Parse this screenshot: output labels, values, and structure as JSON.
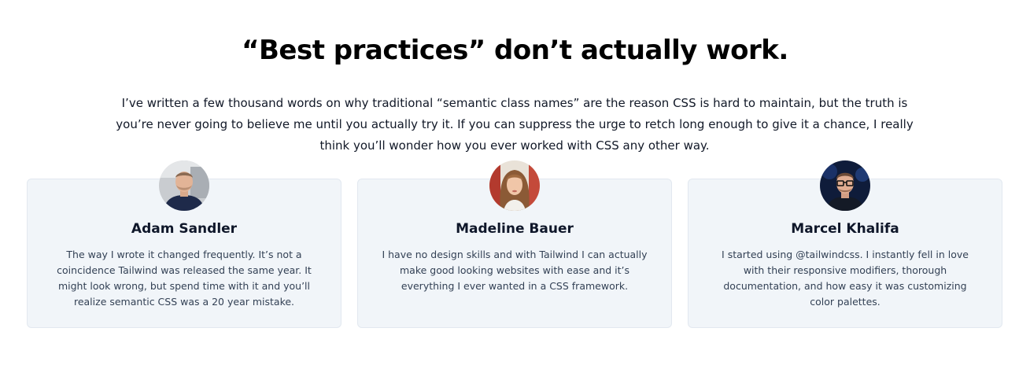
{
  "headline": "“Best practices” don’t actually work.",
  "intro": "I’ve written a few thousand words on why traditional “semantic class names” are the reason CSS is hard to maintain, but the truth is you’re never going to believe me until you actually try it. If you can suppress the urge to retch long enough to give it a chance, I really think you’ll wonder how you ever worked with CSS any other way.",
  "testimonials": [
    {
      "name": "Adam Sandler",
      "quote": "The way I wrote it changed frequently. It’s not a coincidence Tailwind was released the same year. It might look wrong, but spend time with it and you’ll realize semantic CSS was a 20 year mistake.",
      "avatar_icon": "avatar-photo-man-icon"
    },
    {
      "name": "Madeline Bauer",
      "quote": "I have no design skills and with Tailwind I can actually make good looking websites with ease and it’s everything I ever wanted in a CSS framework.",
      "avatar_icon": "avatar-photo-woman-icon"
    },
    {
      "name": "Marcel Khalifa",
      "quote": "I started using @tailwindcss. I instantly fell in love with their responsive modifiers, thorough documentation, and how easy it was customizing color palettes.",
      "avatar_icon": "avatar-photo-man-glasses-icon"
    }
  ],
  "colors": {
    "card_background": "#f1f5f9",
    "card_border": "#e2e8f0",
    "heading": "#000000",
    "body_text": "#334155"
  }
}
